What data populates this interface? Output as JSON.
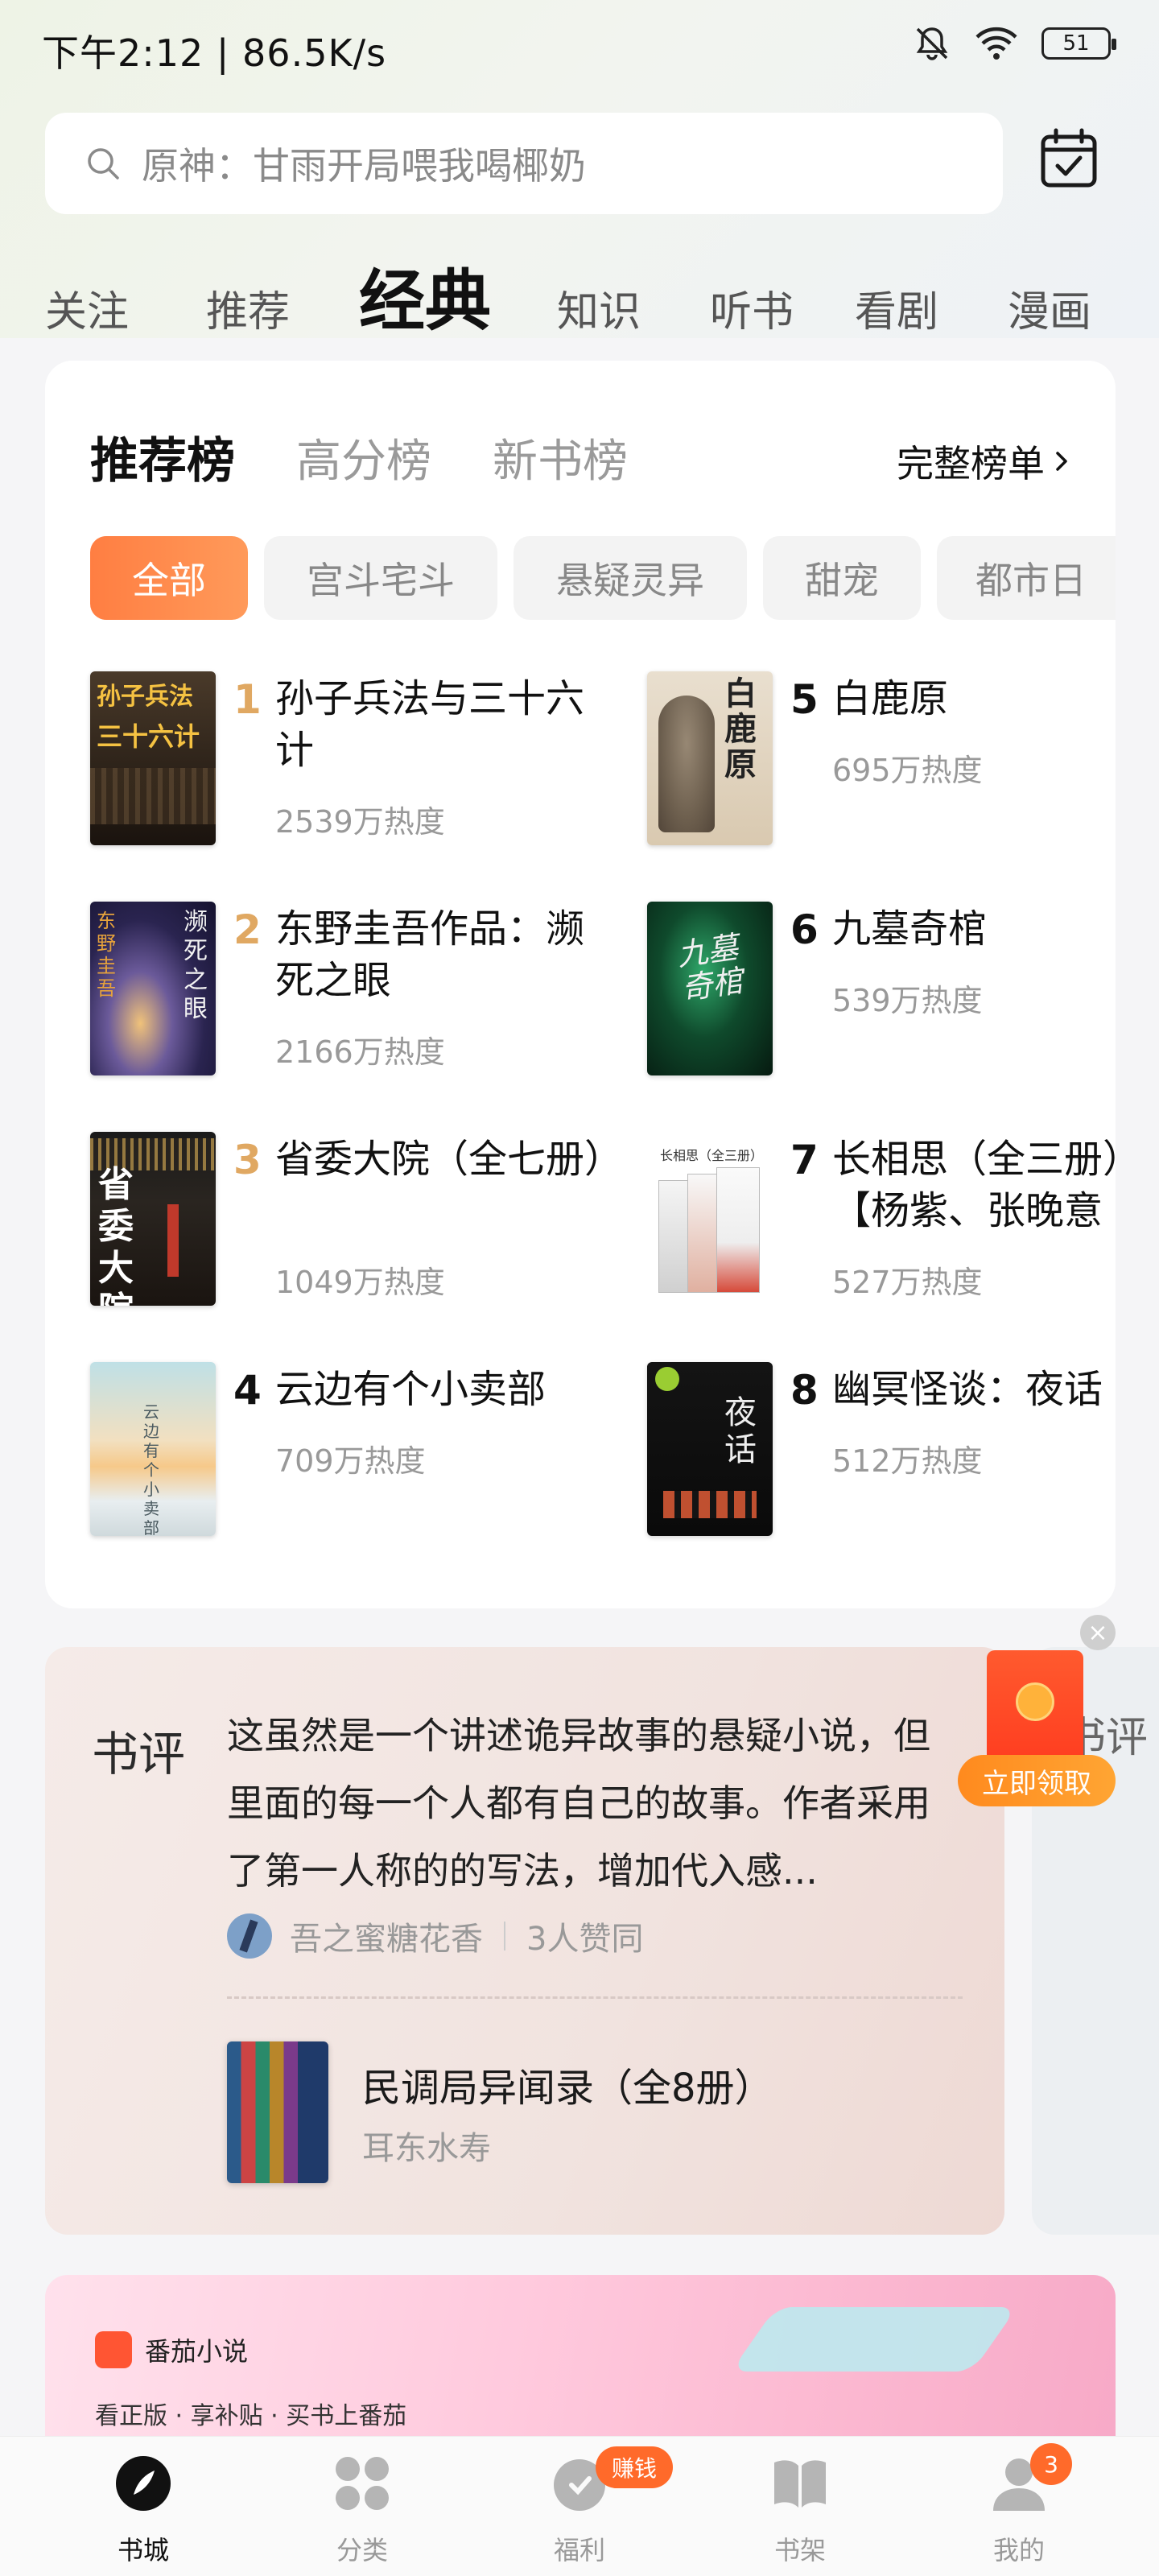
{
  "status_bar": {
    "time_speed": "下午2:12 | 86.5K/s",
    "battery": "51"
  },
  "search": {
    "placeholder": "原神：甘雨开局喂我喝椰奶"
  },
  "main_tabs": [
    "关注",
    "推荐",
    "经典",
    "知识",
    "听书",
    "看剧",
    "漫画"
  ],
  "active_main_tab": "经典",
  "ranking": {
    "tabs": [
      "推荐榜",
      "高分榜",
      "新书榜"
    ],
    "active_tab": "推荐榜",
    "full_list_label": "完整榜单",
    "categories": [
      "全部",
      "宫斗宅斗",
      "悬疑灵异",
      "甜宠",
      "都市日"
    ],
    "active_category": "全部",
    "books": [
      {
        "rank": "1",
        "title": "孙子兵法与三十六计",
        "heat": "2539万热度"
      },
      {
        "rank": "2",
        "title": "东野圭吾作品：濒死之眼",
        "heat": "2166万热度"
      },
      {
        "rank": "3",
        "title": "省委大院（全七册）",
        "heat": "1049万热度"
      },
      {
        "rank": "4",
        "title": "云边有个小卖部",
        "heat": "709万热度"
      },
      {
        "rank": "5",
        "title": "白鹿原",
        "heat": "695万热度"
      },
      {
        "rank": "6",
        "title": "九墓奇棺",
        "heat": "539万热度"
      },
      {
        "rank": "7",
        "title": "长相思（全三册）【杨紫、张晚意",
        "heat": "527万热度"
      },
      {
        "rank": "8",
        "title": "幽冥怪谈：夜话",
        "heat": "512万热度"
      }
    ],
    "cover_texts": {
      "b1": "孙子兵法",
      "b1b": "三十六计",
      "b5": "白鹿原",
      "b2a": "濒死之眼",
      "b2b": "东野圭吾",
      "b6": "九墓奇棺",
      "b3": "省委大院",
      "b7": "长相思（全三册）",
      "b4": "云边有个小卖部",
      "b8": "夜话"
    },
    "rank_colors": {
      "top3": "#e0a862",
      "rest": "#111111"
    }
  },
  "review": {
    "label": "书评",
    "text": "这虽然是一个讲述诡异故事的悬疑小说，但里面的每一个人都有自己的故事。作者采用了第一人称的的写法，增加代入感...",
    "reviewer": "吾之蜜糖花香",
    "likes": "3人赞同",
    "book_title": "民调局异闻录（全8册）",
    "book_author": "耳东水寿",
    "peek_label": "书评"
  },
  "red_packet": {
    "button": "立即领取",
    "close": "×"
  },
  "banner": {
    "brand": "番茄小说",
    "slogan": "看正版 · 享补贴 · 买书上番茄"
  },
  "bottom_nav": {
    "items": [
      "书城",
      "分类",
      "福利",
      "书架",
      "我的"
    ],
    "active": "书城",
    "welfare_badge": "赚钱",
    "mine_badge": "3"
  },
  "colors": {
    "accent": "#ff7e42",
    "badge": "#ff6a2a"
  }
}
